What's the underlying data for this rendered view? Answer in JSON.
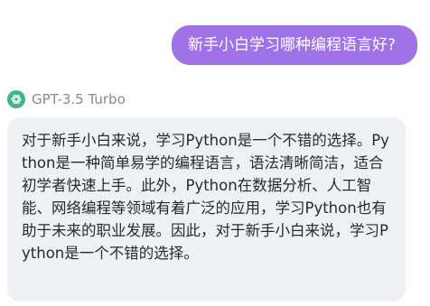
{
  "user_message": {
    "text": "新手小白学习哪种编程语言好?"
  },
  "assistant": {
    "model_name": "GPT-3.5 Turbo",
    "icon": "openai-logo-icon",
    "message": "对于新手小白来说，学习Python是一个不错的选择。Python是一种简单易学的编程语言，语法清晰简洁，适合初学者快速上手。此外，Python在数据分析、人工智能、网络编程等领域有着广泛的应用，学习Python也有助于未来的职业发展。因此，对于新手小白来说，学习Python是一个不错的选择。"
  },
  "colors": {
    "user_bubble": "#9f72e8",
    "assistant_bubble": "#eef0f4",
    "model_icon": "#3fb589"
  }
}
